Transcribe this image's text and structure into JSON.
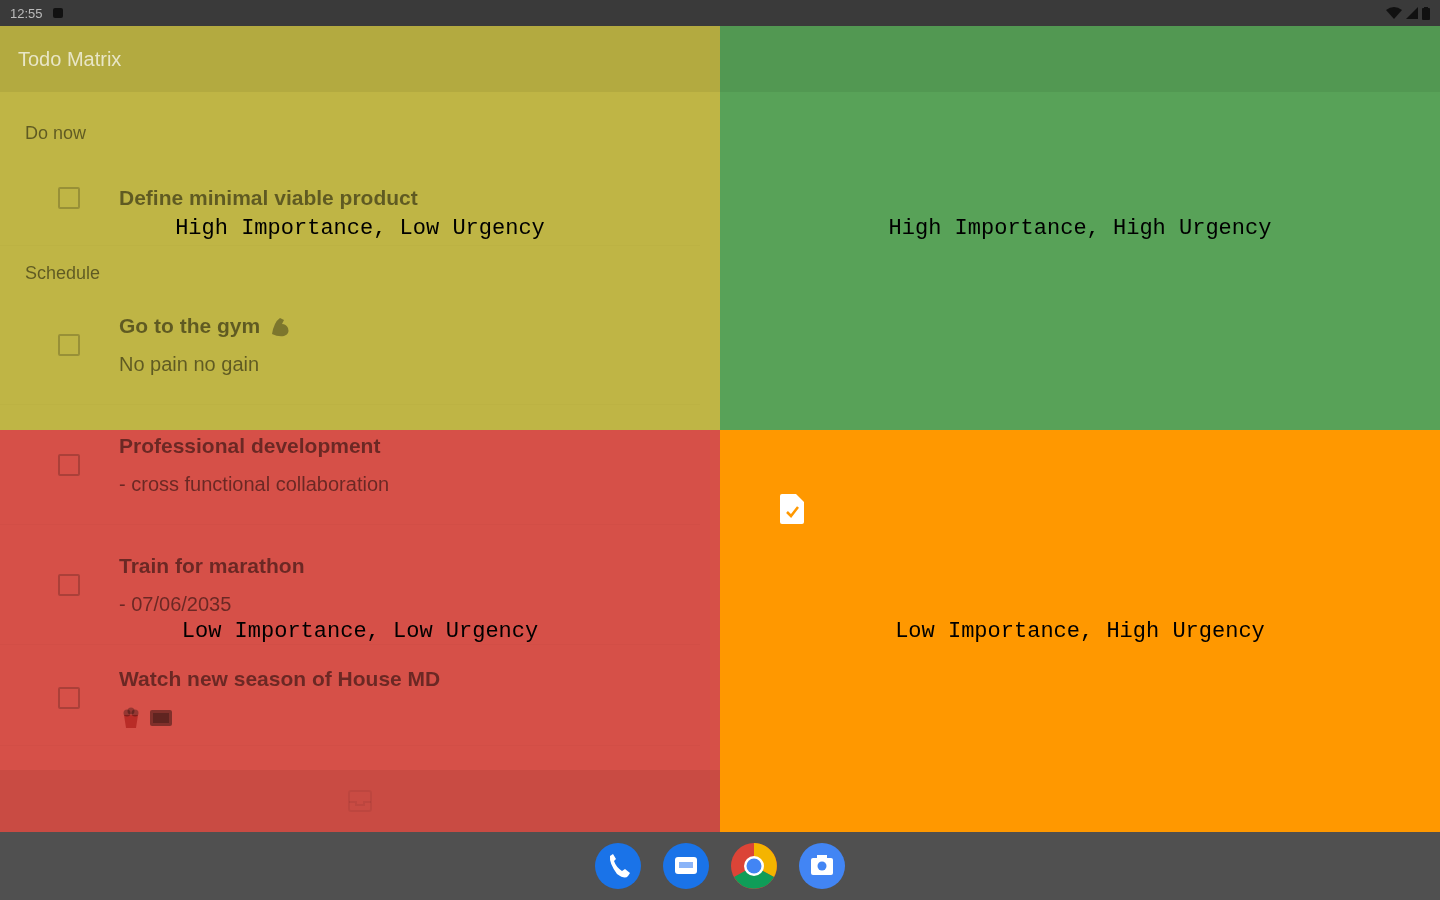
{
  "status_bar": {
    "time": "12:55"
  },
  "app": {
    "title": "Todo Matrix",
    "sections": [
      {
        "header": "Do now",
        "tasks": [
          {
            "title": "Define minimal viable product",
            "checked": false
          }
        ]
      },
      {
        "header": "Schedule",
        "tasks": [
          {
            "title": "Go to the gym",
            "title_icons": [
              {
                "kind": "arm"
              }
            ],
            "subtitle": "No pain no gain",
            "checked": false
          },
          {
            "title": "Professional development",
            "subtitle": "- cross functional collaboration",
            "checked": false
          },
          {
            "title": "Train for marathon",
            "subtitle": "- 07/06/2035",
            "checked": false
          },
          {
            "title": "Watch new season of House MD",
            "note_icons": [
              {
                "kind": "popcorn"
              },
              {
                "kind": "tv"
              }
            ],
            "checked": false
          }
        ]
      }
    ]
  },
  "quadrants": [
    {
      "label": "High Importance, Low Urgency",
      "color": "#bfb545"
    },
    {
      "label": "High Importance, High Urgency",
      "color": "#58a258"
    },
    {
      "label": "Low Importance, Low Urgency",
      "color": "#d65048"
    },
    {
      "label": "Low Importance, High Urgency",
      "color": "#ff9800"
    }
  ],
  "dock": [
    {
      "kind": "phone"
    },
    {
      "kind": "messages"
    },
    {
      "kind": "browser"
    },
    {
      "kind": "camera"
    }
  ]
}
